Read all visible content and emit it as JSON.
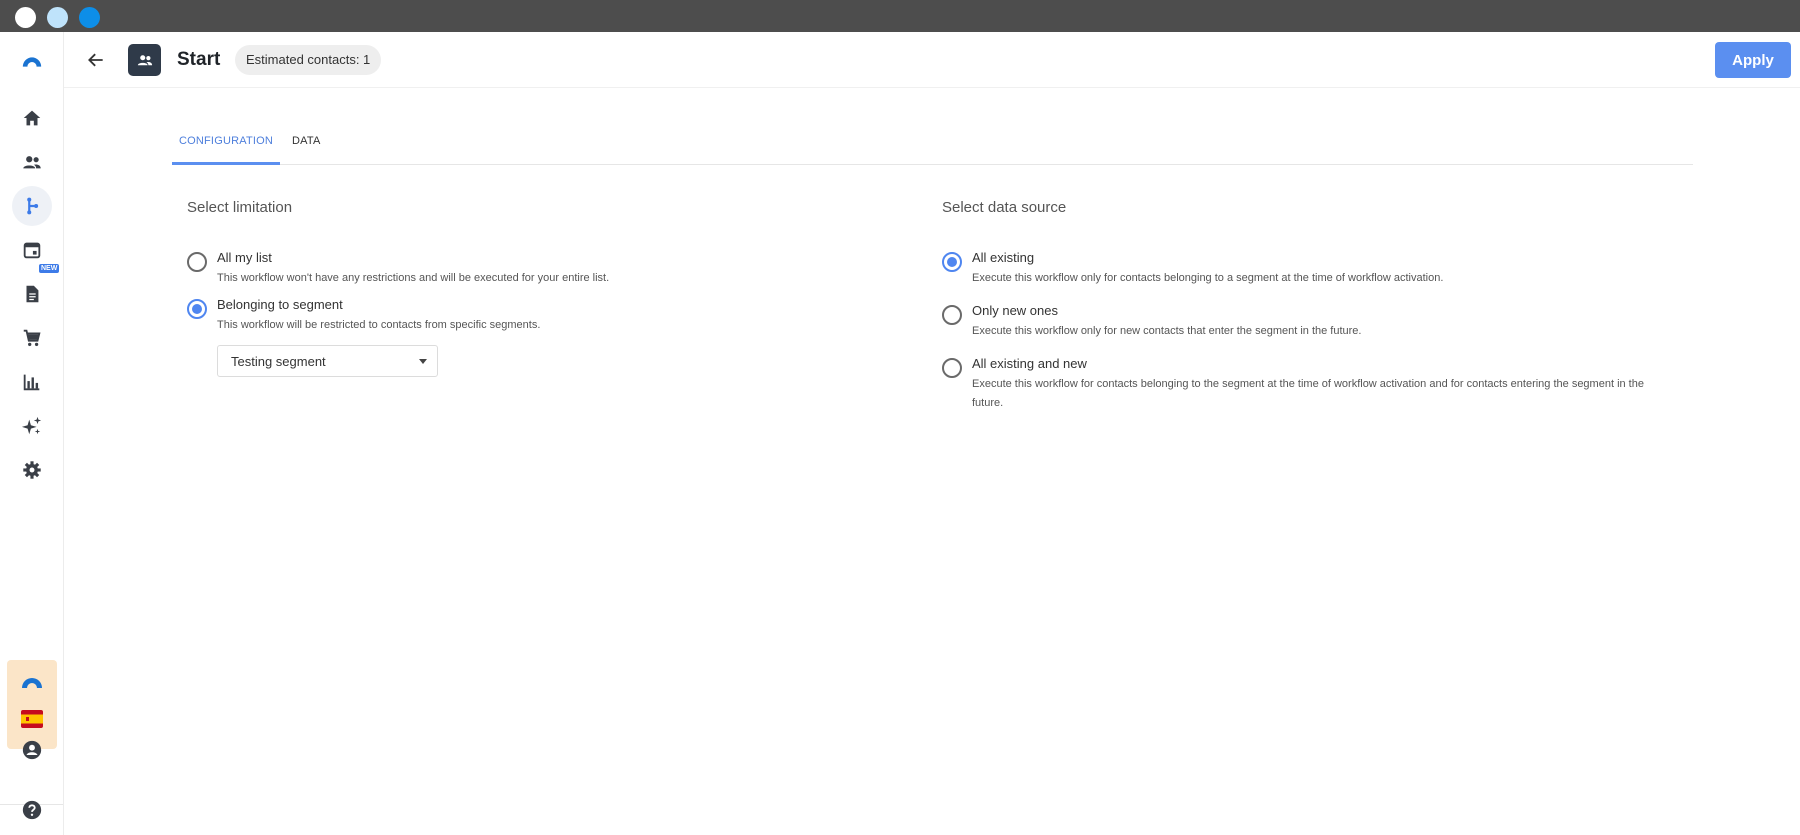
{
  "window": {
    "dots": [
      "close",
      "minimize",
      "zoom"
    ]
  },
  "sidebar": {
    "items": [
      {
        "icon": "logo-icon"
      },
      {
        "icon": "home-icon"
      },
      {
        "icon": "contacts-icon"
      },
      {
        "icon": "workflow-icon",
        "active": true
      },
      {
        "icon": "calendar-icon",
        "badge": "NEW"
      },
      {
        "icon": "document-icon"
      },
      {
        "icon": "cart-icon"
      },
      {
        "icon": "chart-icon"
      },
      {
        "icon": "sparkles-icon"
      },
      {
        "icon": "gear-icon"
      },
      {
        "icon": "account-icon"
      },
      {
        "icon": "help-icon"
      }
    ],
    "new_badge": "NEW",
    "promo": {
      "flag": "spain-flag-icon"
    }
  },
  "header": {
    "title": "Start",
    "contacts_badge": "Estimated contacts: 1",
    "apply_label": "Apply"
  },
  "tabs": [
    {
      "label": "CONFIGURATION",
      "active": true
    },
    {
      "label": "DATA",
      "active": false
    }
  ],
  "limitation": {
    "title": "Select limitation",
    "options": [
      {
        "label": "All my list",
        "description": "This workflow won't have any restrictions and will be executed for your entire list.",
        "checked": false
      },
      {
        "label": "Belonging to segment",
        "description": "This workflow will be restricted to contacts from specific segments.",
        "checked": true
      }
    ],
    "segment_select": {
      "value": "Testing segment"
    }
  },
  "data_source": {
    "title": "Select data source",
    "options": [
      {
        "label": "All existing",
        "description": "Execute this workflow only for contacts belonging to a segment at the time of workflow activation.",
        "checked": true
      },
      {
        "label": "Only new ones",
        "description": "Execute this workflow only for new contacts that enter the segment in the future.",
        "checked": false
      },
      {
        "label": "All existing and new",
        "description": "Execute this workflow for contacts belonging to the segment at the time of workflow activation and for contacts entering the segment in the future.",
        "checked": false
      }
    ]
  },
  "colors": {
    "accent": "#5b8ff0",
    "radio_checked": "#4f86f0",
    "titlebar": "#4d4d4d",
    "node_icon_bg": "#2f3a49"
  }
}
